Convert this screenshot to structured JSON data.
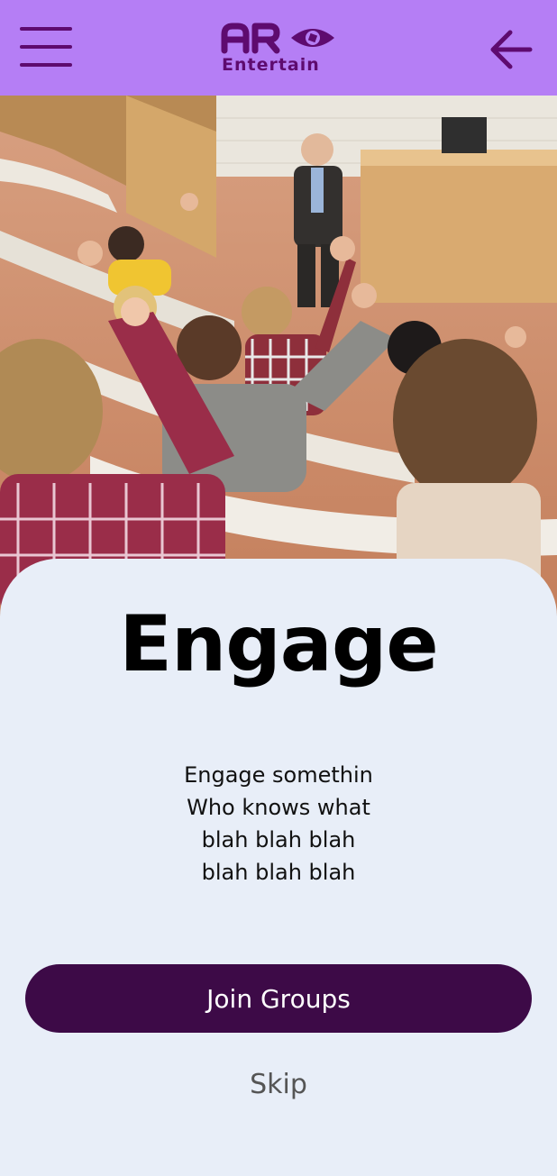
{
  "header": {
    "logo_text_top": "AR",
    "logo_text_bottom": "Entertain",
    "menu_icon": "hamburger-menu-icon",
    "back_icon": "arrow-left-icon",
    "accent_color": "#b57ef5",
    "icon_color": "#5e0b6f"
  },
  "hero": {
    "image": "lecture-hall-students-raising-hands-photo"
  },
  "onboarding": {
    "title": "Engage",
    "description_lines": [
      "Engage somethin",
      "Who knows what",
      "blah blah blah",
      "blah blah blah"
    ],
    "primary_button_label": "Join Groups",
    "skip_label": "Skip",
    "button_color": "#3d0a47",
    "card_color": "#e8eef8"
  }
}
